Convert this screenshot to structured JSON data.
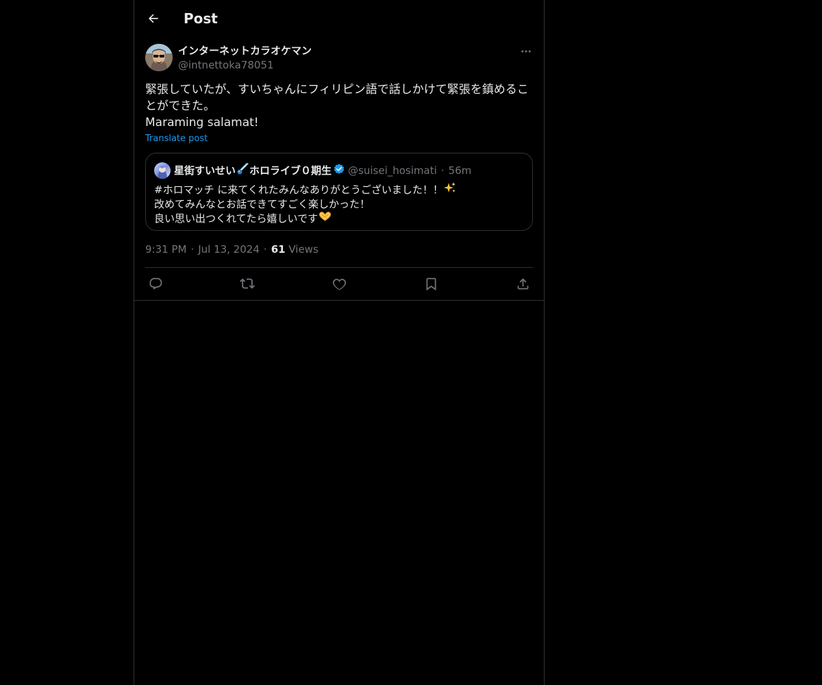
{
  "header": {
    "title": "Post"
  },
  "post": {
    "author": {
      "display_name": "インターネットカラオケマン",
      "handle": "@intnettoka78051"
    },
    "text_lines": [
      "緊張していたが、すいちゃんにフィリピン語で話しかけて緊張を鎮めるこ",
      "とができた。",
      "Maraming salamat!"
    ],
    "translate_label": "Translate post",
    "time": "9:31 PM",
    "date": "Jul 13, 2024",
    "views_count": "61",
    "views_label": "Views"
  },
  "quote": {
    "display_name": "星街すいせい",
    "name_suffix": "ホロライブ０期生",
    "handle": "@suisei_hosimati",
    "time": "56m",
    "lines": [
      "#ホロマッチ に来てくれたみんなありがとうございました！！",
      "改めてみんなとお話できてすごく楽しかった！",
      "良い思い出つくれてたら嬉しいです"
    ]
  },
  "icons": {
    "back": "arrow-left-icon",
    "more": "more-horizontal-icon",
    "verified": "verified-badge-icon",
    "comet": "comet-emoji",
    "sparkles": "sparkles-emoji",
    "heart_hands": "heart-hands-emoji",
    "reply": "reply-icon",
    "repost": "repost-icon",
    "like": "like-icon",
    "bookmark": "bookmark-icon",
    "share": "share-icon"
  },
  "colors": {
    "background": "#000000",
    "text_primary": "#e7e9ea",
    "text_secondary": "#71767b",
    "accent": "#1d9bf0",
    "border": "#2f3336"
  }
}
